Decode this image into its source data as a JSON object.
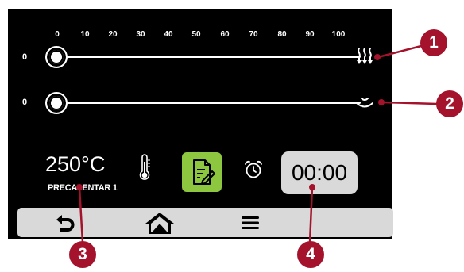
{
  "scale": {
    "ticks": [
      "0",
      "10",
      "20",
      "30",
      "40",
      "50",
      "60",
      "70",
      "80",
      "90",
      "100"
    ]
  },
  "sliders": [
    {
      "value": "0",
      "level": 0,
      "icon": "heat-waves-icon"
    },
    {
      "value": "0",
      "level": 0,
      "icon": "steam-icon"
    }
  ],
  "temperature": {
    "value": "250°C",
    "label": "PRECALENTAR 1"
  },
  "timer": {
    "value": "00:00"
  },
  "nav": {
    "back": "back-arrow-icon",
    "home": "home-icon",
    "menu": "menu-icon"
  },
  "callouts": {
    "c1": "1",
    "c2": "2",
    "c3": "3",
    "c4": "4"
  },
  "colors": {
    "screen_bg": "#000000",
    "recipe_button": "#8dc63f",
    "timer_bg": "#d9d9d9",
    "navbar_bg": "#d9d9d9",
    "callout": "#a4122b"
  }
}
